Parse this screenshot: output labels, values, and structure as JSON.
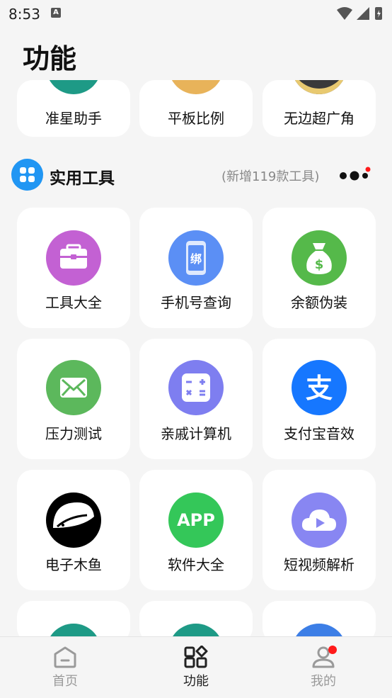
{
  "status_bar": {
    "time": "8:53",
    "notification_icon": "A"
  },
  "page": {
    "title": "功能"
  },
  "top_partial_row": [
    {
      "label": "准星助手",
      "color": "#1e9a86"
    },
    {
      "label": "平板比例",
      "color": "#e8b35a"
    },
    {
      "label": "无边超广角",
      "color": "#3a3a3a"
    }
  ],
  "section": {
    "title": "实用工具",
    "subtitle": "(新增119款工具)",
    "accent": "#2196f3"
  },
  "tools": [
    {
      "label": "工具大全",
      "icon": "toolbox-icon",
      "color": "#c361d3"
    },
    {
      "label": "手机号查询",
      "icon": "phone-lookup-icon",
      "color": "#5b8ff5",
      "glyph": "绑"
    },
    {
      "label": "余额伪装",
      "icon": "money-bag-icon",
      "color": "#55b94a",
      "glyph": "$"
    },
    {
      "label": "压力测试",
      "icon": "envelope-icon",
      "color": "#5cb85c"
    },
    {
      "label": "亲戚计算机",
      "icon": "calculator-icon",
      "color": "#7e7ef0"
    },
    {
      "label": "支付宝音效",
      "icon": "alipay-icon",
      "color": "#1677ff",
      "glyph": "支"
    },
    {
      "label": "电子木鱼",
      "icon": "wooden-fish-icon",
      "color": "#000000"
    },
    {
      "label": "软件大全",
      "icon": "app-store-icon",
      "color": "#34c759",
      "glyph": "APP"
    },
    {
      "label": "短视频解析",
      "icon": "video-parse-icon",
      "color": "#8886f2"
    }
  ],
  "bottom_partial_row": [
    {
      "color": "#1e9a86"
    },
    {
      "color": "#1e9a86"
    },
    {
      "color": "#3c7ee6"
    }
  ],
  "bottom_nav": [
    {
      "label": "首页",
      "icon": "home-icon",
      "active": false
    },
    {
      "label": "功能",
      "icon": "apps-grid-icon",
      "active": true
    },
    {
      "label": "我的",
      "icon": "profile-icon",
      "active": false,
      "badge": true
    }
  ],
  "colors": {
    "background": "#f5f5f5",
    "card": "#ffffff",
    "badge": "#ff1a1a",
    "inactive": "#9a9a9a",
    "active": "#222222"
  }
}
